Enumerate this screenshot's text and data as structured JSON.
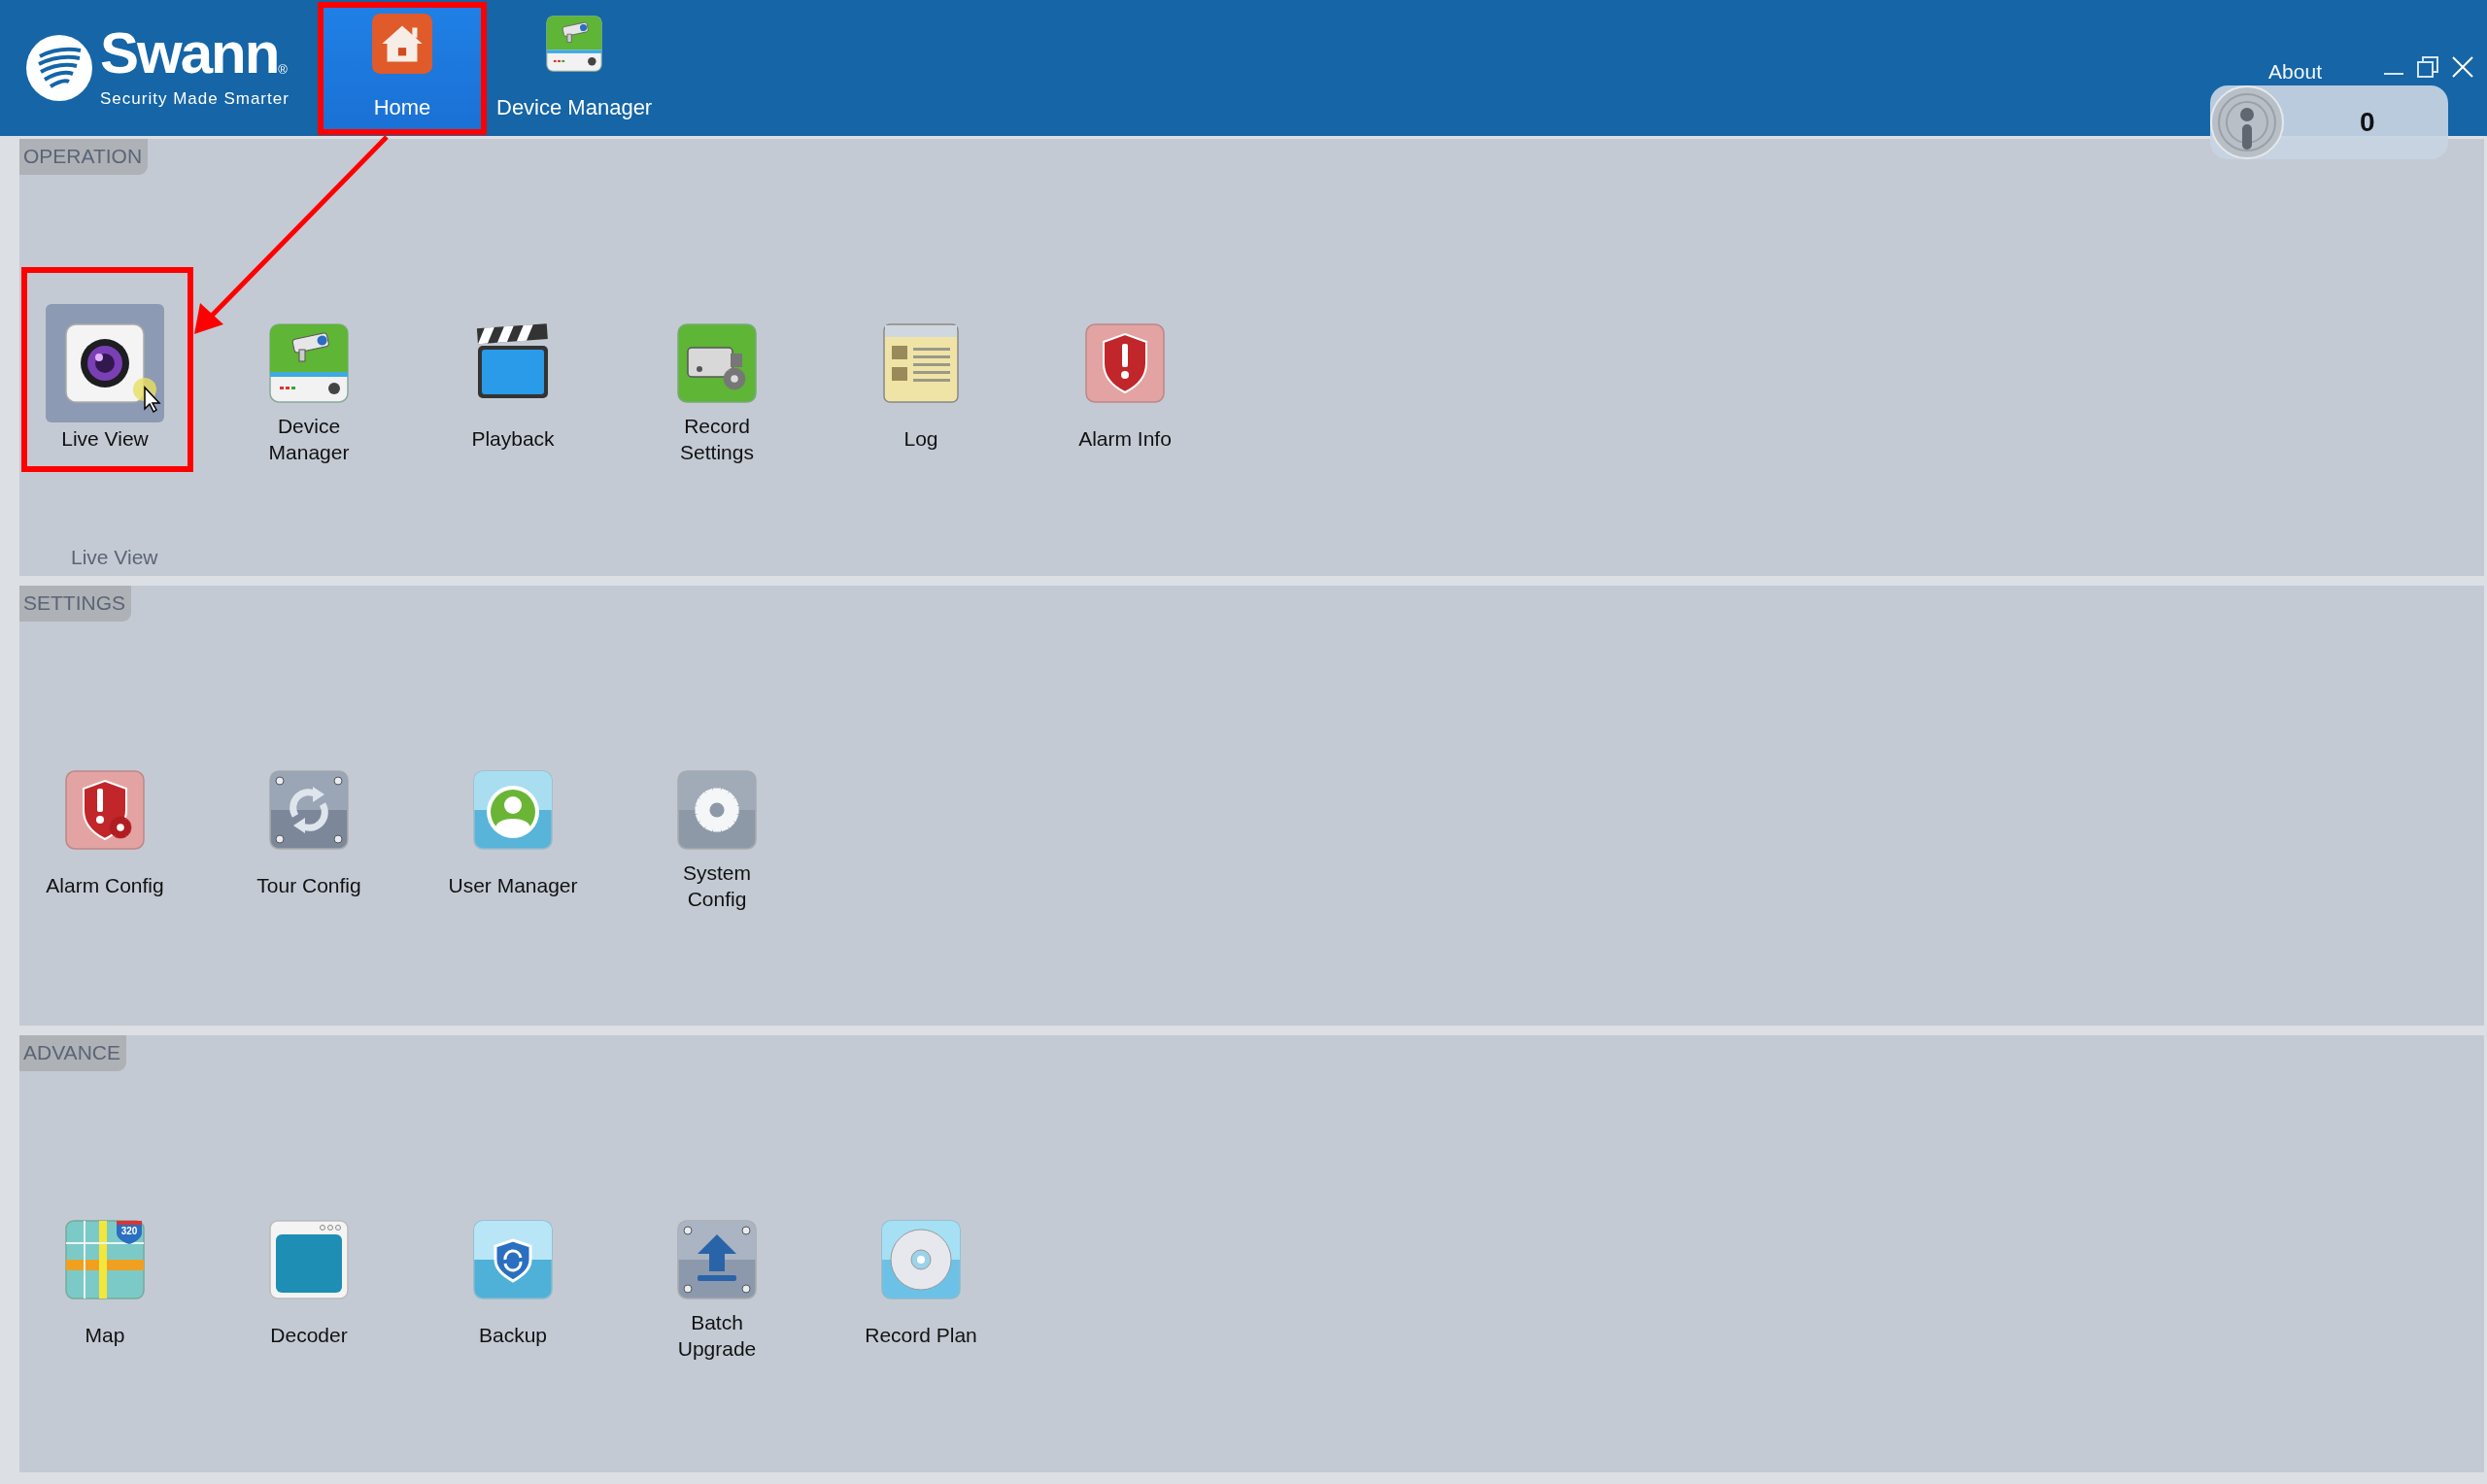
{
  "header": {
    "logo": {
      "brand": "Swann",
      "mark": "®",
      "tagline": "Security Made Smarter"
    },
    "tabs": [
      {
        "label": "Home",
        "selected": true
      },
      {
        "label": "Device Manager",
        "selected": false
      }
    ],
    "about": "About",
    "alarm_counter": {
      "count": "0"
    }
  },
  "sections": [
    {
      "title": "OPERATION",
      "items": [
        {
          "label": [
            "Live View"
          ],
          "selected": true
        },
        {
          "label": [
            "Device",
            "Manager"
          ],
          "selected": false
        },
        {
          "label": [
            "Playback"
          ],
          "selected": false
        },
        {
          "label": [
            "Record",
            "Settings"
          ],
          "selected": false
        },
        {
          "label": [
            "Log"
          ],
          "selected": false
        },
        {
          "label": [
            "Alarm Info"
          ],
          "selected": false
        }
      ],
      "status": "Live View"
    },
    {
      "title": "SETTINGS",
      "items": [
        {
          "label": [
            "Alarm Config"
          ],
          "selected": false
        },
        {
          "label": [
            "Tour Config"
          ],
          "selected": false
        },
        {
          "label": [
            "User Manager"
          ],
          "selected": false
        },
        {
          "label": [
            "System",
            "Config"
          ],
          "selected": false
        }
      ]
    },
    {
      "title": "ADVANCE",
      "items": [
        {
          "label": [
            "Map"
          ],
          "selected": false,
          "badge": "320"
        },
        {
          "label": [
            "Decoder"
          ],
          "selected": false
        },
        {
          "label": [
            "Backup"
          ],
          "selected": false
        },
        {
          "label": [
            "Batch",
            "Upgrade"
          ],
          "selected": false
        },
        {
          "label": [
            "Record Plan"
          ],
          "selected": false
        }
      ]
    }
  ]
}
